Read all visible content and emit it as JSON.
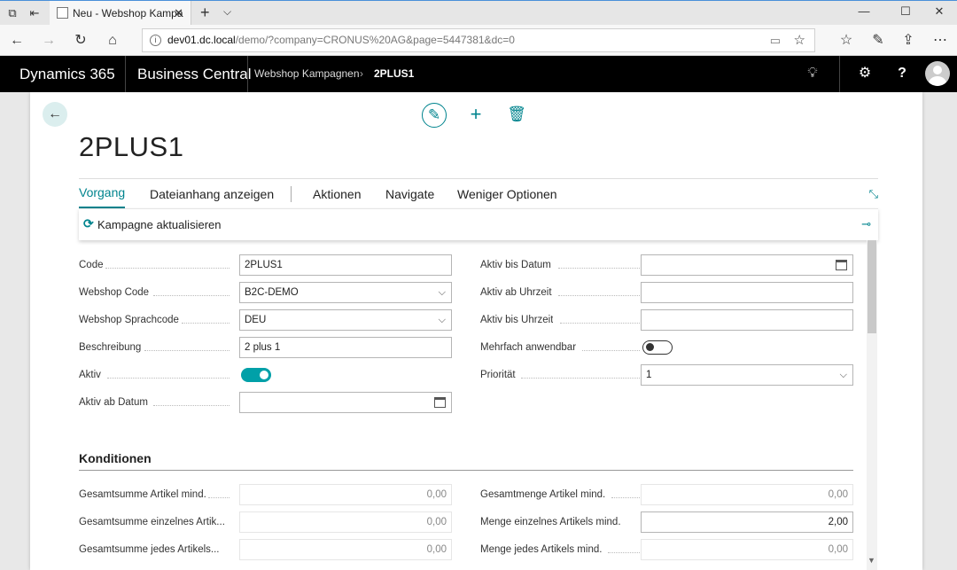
{
  "browser": {
    "tab_title": "Neu - Webshop Kampa",
    "url_host": "dev01.dc.local",
    "url_path": "/demo/?company=CRONUS%20AG&page=5447381&dc=0"
  },
  "app": {
    "brand": "Dynamics 365",
    "product": "Business Central",
    "breadcrumb": [
      "Webshop Kampagnen",
      "2PLUS1"
    ]
  },
  "page": {
    "title": "2PLUS1",
    "actions": [
      "Vorgang",
      "Dateianhang anzeigen",
      "Aktionen",
      "Navigate",
      "Weniger Optionen"
    ],
    "subaction": "Kampagne aktualisieren"
  },
  "general": {
    "left": [
      {
        "label": "Code",
        "value": "2PLUS1",
        "type": "text"
      },
      {
        "label": "Webshop Code",
        "value": "B2C-DEMO",
        "type": "select"
      },
      {
        "label": "Webshop Sprachcode",
        "value": "DEU",
        "type": "select"
      },
      {
        "label": "Beschreibung",
        "value": "2 plus 1",
        "type": "text"
      },
      {
        "label": "Aktiv",
        "value": true,
        "type": "toggle"
      },
      {
        "label": "Aktiv ab Datum",
        "value": "",
        "type": "date"
      }
    ],
    "right": [
      {
        "label": "Aktiv bis Datum",
        "value": "",
        "type": "date"
      },
      {
        "label": "Aktiv ab Uhrzeit",
        "value": "",
        "type": "text"
      },
      {
        "label": "Aktiv bis Uhrzeit",
        "value": "",
        "type": "text"
      },
      {
        "label": "Mehrfach anwendbar",
        "value": false,
        "type": "toggle"
      },
      {
        "label": "Priorität",
        "value": "1",
        "type": "select"
      }
    ]
  },
  "conditions": {
    "title": "Konditionen",
    "left": [
      {
        "label": "Gesamtsumme Artikel mind.",
        "value": "0,00"
      },
      {
        "label": "Gesamtsumme einzelnes Artik...",
        "value": "0,00"
      },
      {
        "label": "Gesamtsumme jedes Artikels...",
        "value": "0,00"
      }
    ],
    "right": [
      {
        "label": "Gesamtmenge Artikel mind.",
        "value": "0,00"
      },
      {
        "label": "Menge einzelnes Artikels mind.",
        "value": "2,00"
      },
      {
        "label": "Menge jedes Artikels mind.",
        "value": "0,00"
      }
    ]
  },
  "colors": {
    "accent": "#00848e",
    "toggle_on": "#00a0a8",
    "header_bg": "#000000"
  }
}
